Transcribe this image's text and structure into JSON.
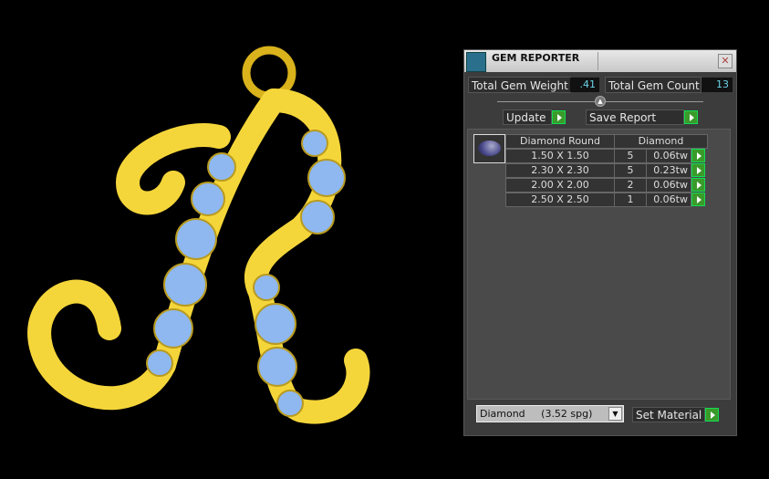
{
  "window": {
    "title": "GEM REPORTER"
  },
  "stats": {
    "weight_label": "Total Gem Weight",
    "weight_value": ".41",
    "count_label": "Total Gem Count",
    "count_value": "13"
  },
  "buttons": {
    "update": "Update",
    "save": "Save Report",
    "set_material": "Set Material"
  },
  "table": {
    "headers": [
      "Diamond Round",
      "Diamond"
    ],
    "rows": [
      [
        "1.50 X 1.50",
        "5",
        "0.06tw"
      ],
      [
        "2.30 X 2.30",
        "5",
        "0.23tw"
      ],
      [
        "2.00 X 2.00",
        "2",
        "0.06tw"
      ],
      [
        "2.50 X 2.50",
        "1",
        "0.06tw"
      ]
    ]
  },
  "material": {
    "selected": "Diamond     (3.52 spg)"
  },
  "colors": {
    "gold": "#f5d63a",
    "gem": "#8fb8f0",
    "accent": "#3a9a2a"
  }
}
